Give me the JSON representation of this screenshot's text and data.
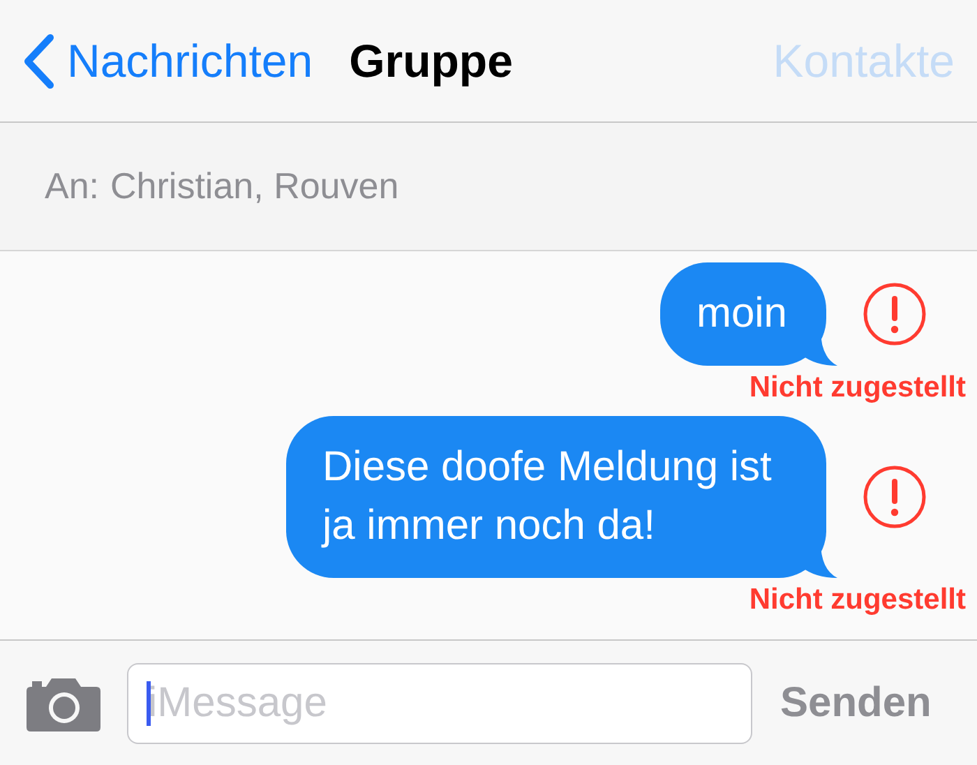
{
  "nav_bar": {
    "back_label": "Nachrichten",
    "title": "Gruppe",
    "action": {
      "label": "Kontakte",
      "disabled": true
    }
  },
  "recipients": {
    "label": "An:",
    "names": "Christian, Rouven"
  },
  "messages": [
    {
      "text": "moin",
      "delivered": false,
      "status": "Nicht zugestellt"
    },
    {
      "text": "Diese doofe Meldung ist ja immer noch da!",
      "delivered": false,
      "status": "Nicht zugestellt"
    }
  ],
  "composer": {
    "placeholder": "iMessage",
    "focused": true,
    "send": {
      "label": "Senden",
      "disabled": true
    }
  }
}
